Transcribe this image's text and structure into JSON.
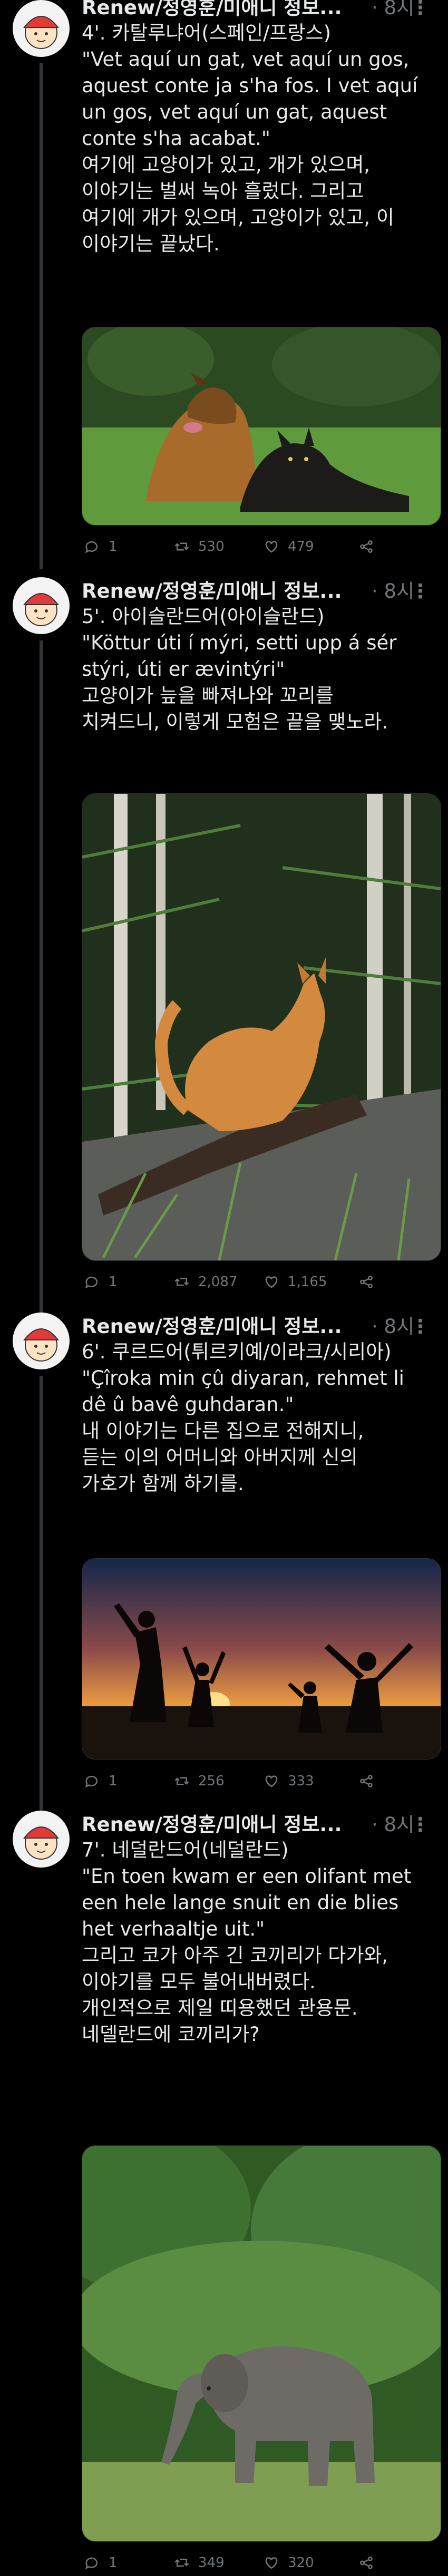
{
  "tweets": [
    {
      "author": "Renew/정영훈/미애니 정보...",
      "time": "· 8시",
      "more": "⋮",
      "lines": [
        "4'. 카탈루냐어(스페인/프랑스)",
        "",
        "\"Vet aquí un gat, vet aquí un gos,",
        "aquest conte ja s'ha fos. I vet aquí",
        "un gos, vet aquí un gat, aquest",
        "conte s'ha acabat.\"",
        "여기에 고양이가 있고, 개가 있으며,",
        "이야기는 벌써 녹아 흘렀다. 그리고",
        "여기에 개가 있으며, 고양이가 있고, 이",
        "이야기는 끝났다."
      ],
      "media": "dog and cat lying on grass",
      "stats": {
        "replies": "1",
        "retweets": "530",
        "likes": "479"
      }
    },
    {
      "author": "Renew/정영훈/미애니 정보...",
      "time": "· 8시",
      "more": "⋮",
      "lines": [
        "5'. 아이슬란드어(아이슬란드)",
        "",
        "\"Köttur úti í mýri, setti upp á sér",
        "stýri, úti er ævintýri\"",
        "고양이가 늪을 빠져나와 꼬리를",
        "치켜드니, 이렇게 모험은 끝을 맺노라."
      ],
      "media": "orange cat on a log in a forest",
      "stats": {
        "replies": "1",
        "retweets": "2,087",
        "likes": "1,165"
      }
    },
    {
      "author": "Renew/정영훈/미애니 정보...",
      "time": "· 8시",
      "more": "⋮",
      "lines": [
        "6'. 쿠르드어(튀르키예/이라크/시리아)",
        "",
        "\"Çîroka min çû diyaran, rehmet li",
        "dê û bavê guhdaran.\"",
        "내 이야기는 다른 집으로 전해지니,",
        "듣는 이의 어머니와 아버지께 신의",
        "가호가 함께 하기를."
      ],
      "media": "family silhouettes at sunset on beach",
      "stats": {
        "replies": "1",
        "retweets": "256",
        "likes": "333"
      }
    },
    {
      "author": "Renew/정영훈/미애니 정보...",
      "time": "· 8시",
      "more": "⋮",
      "lines": [
        "7'. 네덜란드어(네덜란드)",
        "",
        "\"En toen kwam er een olifant met",
        "een hele lange snuit en die blies",
        "het verhaaltje uit.\"",
        "그리고 코가 아주 긴 코끼리가 다가와,",
        "이야기를 모두 불어내버렸다.",
        "",
        "개인적으로 제일 띠용했던 관용문.",
        "네델란드에 코끼리가?"
      ],
      "media": "elephant in a green forest",
      "stats": {
        "replies": "1",
        "retweets": "349",
        "likes": "320"
      }
    }
  ]
}
